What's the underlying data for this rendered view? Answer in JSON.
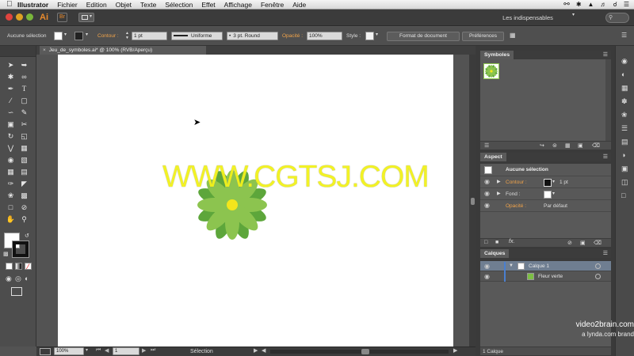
{
  "menubar": {
    "app_name": "Illustrator",
    "items": [
      "Fichier",
      "Edition",
      "Objet",
      "Texte",
      "Sélection",
      "Effet",
      "Affichage",
      "Fenêtre",
      "Aide"
    ]
  },
  "app_bar": {
    "logo_text": "Ai",
    "bridge_text": "Br",
    "workspace": "Les indispensables"
  },
  "control_bar": {
    "selection_label": "Aucune sélection",
    "contour_label": "Contour :",
    "contour_value": "1 pt",
    "stroke_style": "Uniforme",
    "brush_value": "3 pt. Round",
    "opacity_label": "Opacité :",
    "opacity_value": "100%",
    "style_label": "Style :",
    "doc_format_button": "Format de document",
    "preferences_button": "Préférences"
  },
  "document": {
    "tab_title": "Jeu_de_symboles.ai* @ 100% (RVB/Aperçu)",
    "watermark": "WWW.CGTSJ.COM"
  },
  "status_bar": {
    "zoom": "100%",
    "artboard_number": "1",
    "status_text": "Sélection"
  },
  "symbols_panel": {
    "title": "Symboles"
  },
  "aspect_panel": {
    "title": "Aspect",
    "header": "Aucune sélection",
    "rows": [
      {
        "label": "Contour :",
        "value": "1 pt"
      },
      {
        "label": "Fond :",
        "value": ""
      },
      {
        "label": "Opacité :",
        "value": "Par défaut"
      }
    ]
  },
  "layers_panel": {
    "title": "Calques",
    "layers": [
      {
        "name": "Calque 1"
      },
      {
        "name": "Fleur verte"
      }
    ],
    "count": "1 Calque"
  },
  "brand": {
    "line1": "video2brain.com",
    "line2": "a lynda.com brand"
  },
  "colors": {
    "accent": "#f0a34a",
    "petal_dark": "#5da63b",
    "petal_light": "#8cc44f",
    "center": "#f3e61c",
    "watermark": "#f2f21a"
  }
}
